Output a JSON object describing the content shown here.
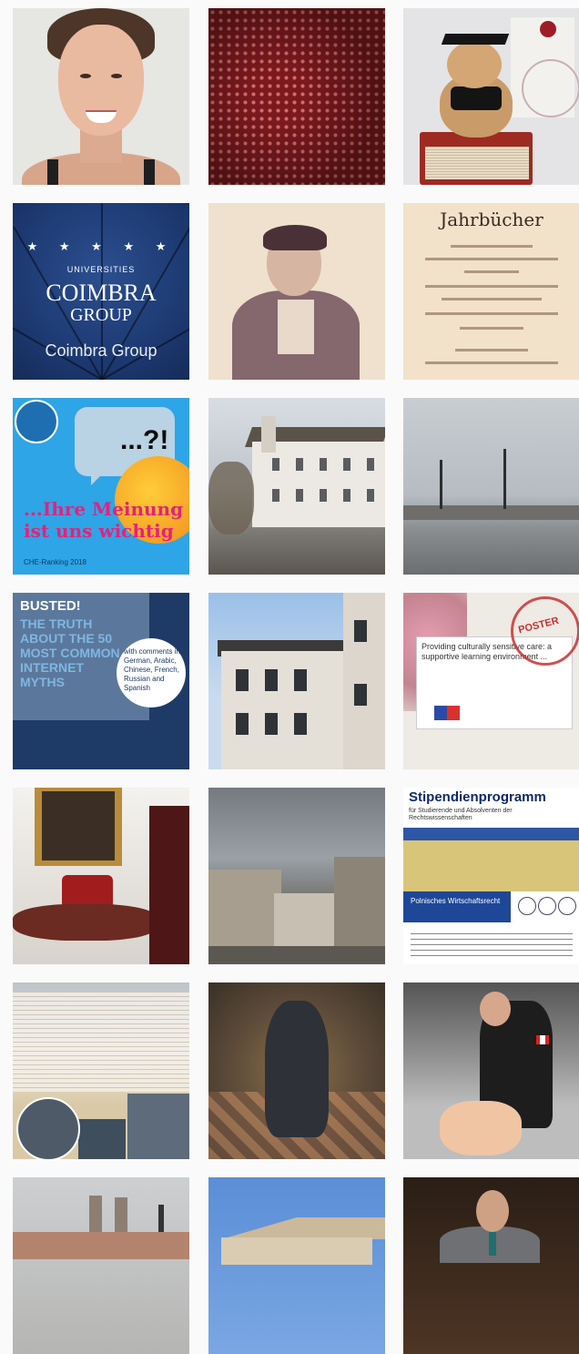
{
  "tiles": [
    {
      "id": "t1",
      "alt": "portrait-woman"
    },
    {
      "id": "t2",
      "alt": "red-dots"
    },
    {
      "id": "t3",
      "alt": "teddy-bear-graduate"
    },
    {
      "id": "t4",
      "alt": "coimbra-group",
      "text": {
        "stars": "★ ★ ★ ★ ★",
        "universities": "UNIVERSITIES",
        "main1": "COIMBRA",
        "main2": "GROUP",
        "footer": "Coimbra Group"
      }
    },
    {
      "id": "t5",
      "alt": "sketch-portrait"
    },
    {
      "id": "t6",
      "alt": "old-document",
      "text": {
        "heading": "Jahrbücher"
      }
    },
    {
      "id": "t7",
      "alt": "ihre-meinung",
      "text": {
        "question": "...?!",
        "line1": "...Ihre Meinung",
        "line2": "ist uns wichtig",
        "footer": "CHE-Ranking 2018"
      }
    },
    {
      "id": "t8",
      "alt": "historic-building"
    },
    {
      "id": "t9",
      "alt": "foggy-bridge"
    },
    {
      "id": "t10",
      "alt": "busted-book",
      "text": {
        "busted": "BUSTED!",
        "headline": "THE TRUTH ABOUT THE 50 MOST COMMON INTERNET MYTHS",
        "circle": "with comments in German, Arabic, Chinese, French, Russian and Spanish"
      }
    },
    {
      "id": "t11",
      "alt": "villa-building"
    },
    {
      "id": "t12",
      "alt": "poster-award",
      "text": {
        "card": "Providing culturally sensitive care: a supportive learning environment ...",
        "stamp": "POSTER"
      }
    },
    {
      "id": "t13",
      "alt": "interior-painting"
    },
    {
      "id": "t14",
      "alt": "old-town-square"
    },
    {
      "id": "t15",
      "alt": "stipendienprogramm",
      "text": {
        "title": "Stipendienprogramm",
        "subtitle": "für Studierende und Absolventen der Rechtswissenschaften",
        "box": "Polnisches Wirtschaftsrecht"
      }
    },
    {
      "id": "t16",
      "alt": "paper-stacks"
    },
    {
      "id": "t17",
      "alt": "fresco"
    },
    {
      "id": "t18",
      "alt": "cpr-training"
    },
    {
      "id": "t19",
      "alt": "castle-foggy"
    },
    {
      "id": "t20",
      "alt": "classical-building"
    },
    {
      "id": "t21",
      "alt": "speaker-portrait"
    }
  ]
}
